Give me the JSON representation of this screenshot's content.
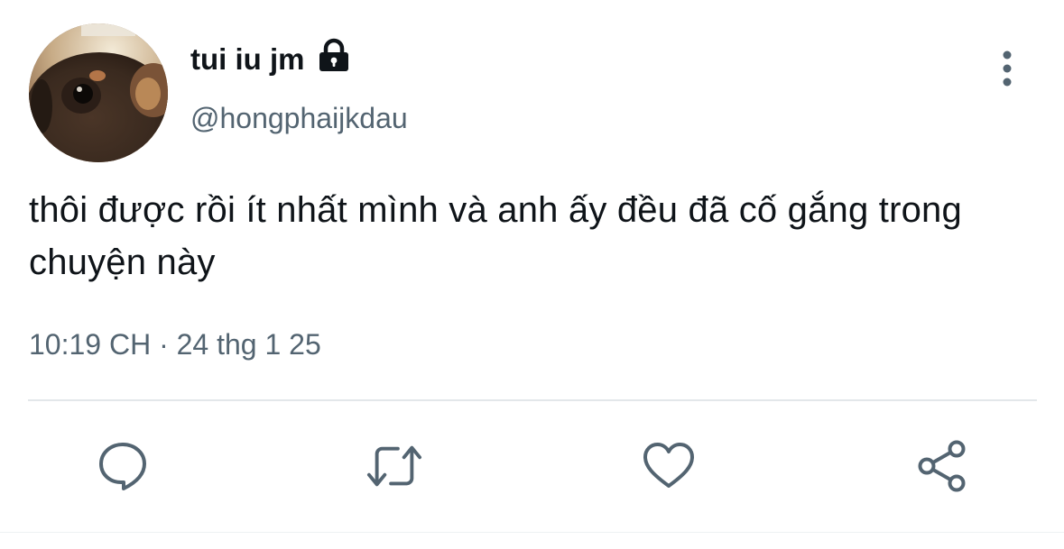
{
  "tweet": {
    "display_name": "tui iu jm",
    "handle": "@hongphaijkdau",
    "text": "thôi được rồi ít nhất mình và anh ấy đều đã cố gắng trong chuyện này",
    "timestamp": "10:19 CH · 24 thg 1 25",
    "protected": true
  },
  "icons": {
    "lock": "lock-icon",
    "more": "more-vertical-icon",
    "reply": "reply-icon",
    "retweet": "retweet-icon",
    "like": "heart-icon",
    "share": "share-icon"
  },
  "colors": {
    "text_primary": "#0f1419",
    "text_secondary": "#536471",
    "icon": "#536471",
    "divider": "#e3e7ea"
  }
}
